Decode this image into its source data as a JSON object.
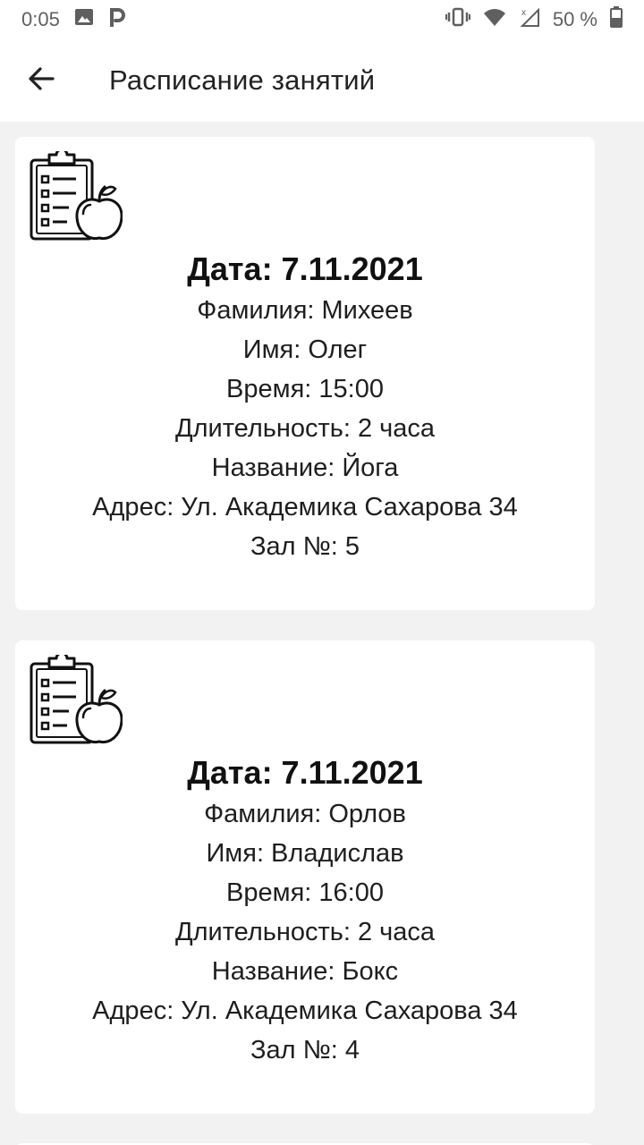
{
  "status_bar": {
    "time": "0:05",
    "battery": "50 %",
    "icons": [
      "image-icon",
      "p-app-icon",
      "vibrate-icon",
      "wifi-icon",
      "no-signal-icon",
      "battery-icon"
    ]
  },
  "app_bar": {
    "title": "Расписание занятий",
    "back_icon": "arrow-back-icon"
  },
  "cards": [
    {
      "icon": "clipboard-apple-icon",
      "date": "Дата: 7.11.2021",
      "surname": "Фамилия: Михеев",
      "name": "Имя: Олег",
      "time": "Время: 15:00",
      "duration": "Длительность: 2 часа",
      "title": "Название: Йога",
      "address": "Адрес: Ул. Академика Сахарова 34",
      "hall": "Зал №: 5"
    },
    {
      "icon": "clipboard-apple-icon",
      "date": "Дата: 7.11.2021",
      "surname": "Фамилия: Орлов",
      "name": "Имя: Владислав",
      "time": "Время: 16:00",
      "duration": "Длительность: 2 часа",
      "title": "Название: Бокс",
      "address": "Адрес: Ул. Академика Сахарова 34",
      "hall": "Зал №: 4"
    }
  ]
}
